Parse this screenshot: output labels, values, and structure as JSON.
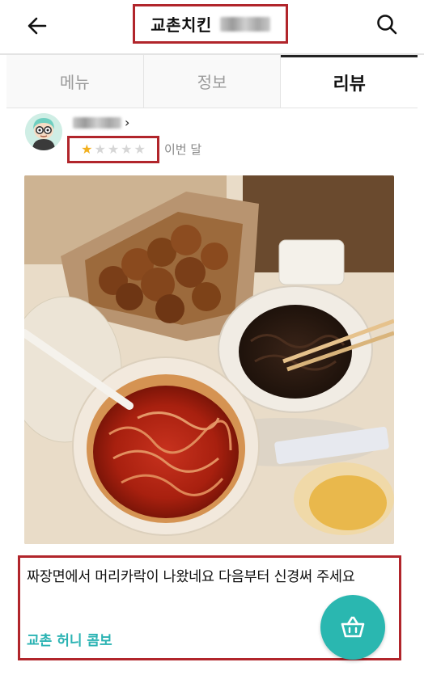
{
  "header": {
    "title": "교촌치킨",
    "back_icon": "back-arrow-icon",
    "search_icon": "search-icon"
  },
  "tabs": [
    {
      "label": "메뉴",
      "active": false
    },
    {
      "label": "정보",
      "active": false
    },
    {
      "label": "리뷰",
      "active": true
    }
  ],
  "review": {
    "rating": 1,
    "rating_max": 5,
    "date": "이번 달",
    "text": "짜장면에서 머리카락이 나왔네요 다음부터 신경써 주세요",
    "menu_item": "교촌 허니 콤보"
  },
  "colors": {
    "accent": "#2ab7b0",
    "highlight_border": "#b1252b",
    "star": "#f2b01e"
  },
  "fab": {
    "icon": "cart-basket-icon"
  }
}
